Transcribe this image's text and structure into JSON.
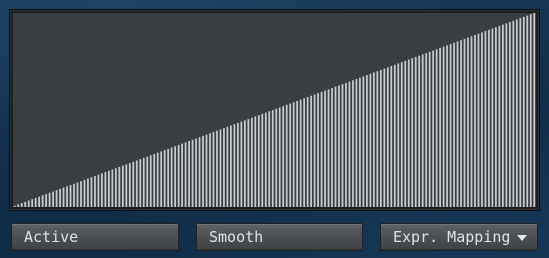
{
  "table": {
    "shape": "linear-ramp",
    "min_value": 0,
    "max_value": 1,
    "bar_count": 150,
    "bar_color": "#c9cdd0",
    "background_color": "#3b3e41"
  },
  "controls": {
    "active_label": "Active",
    "smooth_label": "Smooth",
    "mapping_label": "Expr. Mapping"
  }
}
